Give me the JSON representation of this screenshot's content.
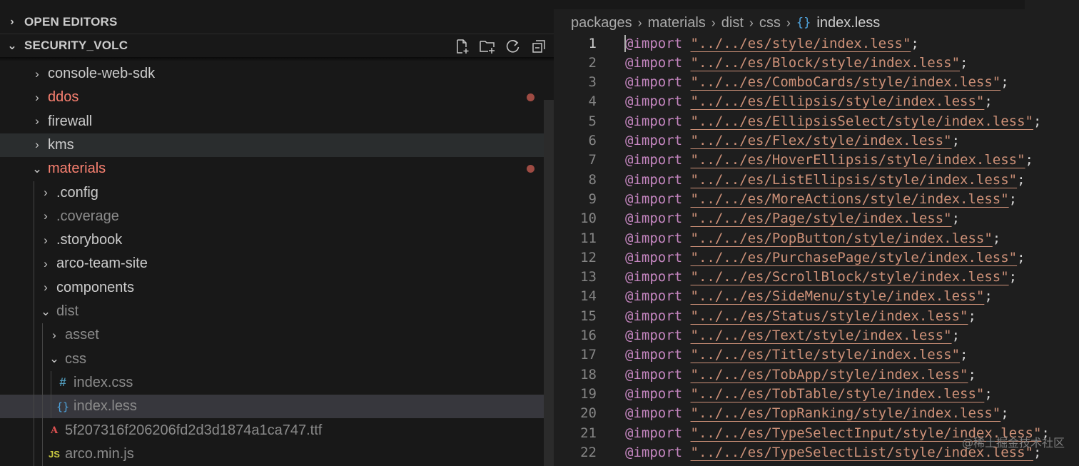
{
  "sidebar": {
    "open_editors_label": "OPEN EDITORS",
    "workspace_label": "SECURITY_VOLC",
    "actions": [
      {
        "icon": "new-file-icon"
      },
      {
        "icon": "new-folder-icon"
      },
      {
        "icon": "refresh-icon"
      },
      {
        "icon": "collapse-all-icon"
      }
    ],
    "tree": [
      {
        "label": "console-web-sdk",
        "type": "folder",
        "expanded": false,
        "depth": 0
      },
      {
        "label": "ddos",
        "type": "folder",
        "expanded": false,
        "depth": 0,
        "modified": true
      },
      {
        "label": "firewall",
        "type": "folder",
        "expanded": false,
        "depth": 0
      },
      {
        "label": "kms",
        "type": "folder",
        "expanded": false,
        "depth": 0,
        "hover": true
      },
      {
        "label": "materials",
        "type": "folder",
        "expanded": true,
        "depth": 0,
        "modified": true
      },
      {
        "label": ".config",
        "type": "folder",
        "expanded": false,
        "depth": 1
      },
      {
        "label": ".coverage",
        "type": "folder",
        "expanded": false,
        "depth": 1,
        "dim": true
      },
      {
        "label": ".storybook",
        "type": "folder",
        "expanded": false,
        "depth": 1
      },
      {
        "label": "arco-team-site",
        "type": "folder",
        "expanded": false,
        "depth": 1
      },
      {
        "label": "components",
        "type": "folder",
        "expanded": false,
        "depth": 1
      },
      {
        "label": "dist",
        "type": "folder",
        "expanded": true,
        "depth": 1,
        "dim": true
      },
      {
        "label": "asset",
        "type": "folder",
        "expanded": false,
        "depth": 2,
        "dim": true
      },
      {
        "label": "css",
        "type": "folder",
        "expanded": true,
        "depth": 2,
        "dim": true
      },
      {
        "label": "index.css",
        "type": "css",
        "depth": 3,
        "dim": true,
        "icon_glyph": "#"
      },
      {
        "label": "index.less",
        "type": "less",
        "depth": 3,
        "dim": true,
        "selected": true,
        "icon_glyph": "{}"
      },
      {
        "label": "5f207316f206206fd2d3d1874a1ca747.ttf",
        "type": "font",
        "depth": 2,
        "dim": true,
        "icon_glyph": "A"
      },
      {
        "label": "arco.min.js",
        "type": "js",
        "depth": 2,
        "dim": true,
        "icon_glyph": "JS"
      }
    ]
  },
  "colors": {
    "modified": "#f88070",
    "keyword": "#c586c0",
    "string": "#ce9178",
    "css_icon": "#519aba",
    "less_icon": "#4fa3dc",
    "js_icon": "#cbcb41",
    "font_icon": "#e05252"
  },
  "editor": {
    "breadcrumb": [
      "packages",
      "materials",
      "dist",
      "css"
    ],
    "breadcrumb_icon_glyph": "{}",
    "breadcrumb_file": "index.less",
    "active_line": 1,
    "lines": [
      {
        "n": "1",
        "kw": "@import",
        "str": "\"../../es/style/index.less\""
      },
      {
        "n": "2",
        "kw": "@import",
        "str": "\"../../es/Block/style/index.less\""
      },
      {
        "n": "3",
        "kw": "@import",
        "str": "\"../../es/ComboCards/style/index.less\""
      },
      {
        "n": "4",
        "kw": "@import",
        "str": "\"../../es/Ellipsis/style/index.less\""
      },
      {
        "n": "5",
        "kw": "@import",
        "str": "\"../../es/EllipsisSelect/style/index.less\""
      },
      {
        "n": "6",
        "kw": "@import",
        "str": "\"../../es/Flex/style/index.less\""
      },
      {
        "n": "7",
        "kw": "@import",
        "str": "\"../../es/HoverEllipsis/style/index.less\""
      },
      {
        "n": "8",
        "kw": "@import",
        "str": "\"../../es/ListEllipsis/style/index.less\""
      },
      {
        "n": "9",
        "kw": "@import",
        "str": "\"../../es/MoreActions/style/index.less\""
      },
      {
        "n": "10",
        "kw": "@import",
        "str": "\"../../es/Page/style/index.less\""
      },
      {
        "n": "11",
        "kw": "@import",
        "str": "\"../../es/PopButton/style/index.less\""
      },
      {
        "n": "12",
        "kw": "@import",
        "str": "\"../../es/PurchasePage/style/index.less\""
      },
      {
        "n": "13",
        "kw": "@import",
        "str": "\"../../es/ScrollBlock/style/index.less\""
      },
      {
        "n": "14",
        "kw": "@import",
        "str": "\"../../es/SideMenu/style/index.less\""
      },
      {
        "n": "15",
        "kw": "@import",
        "str": "\"../../es/Status/style/index.less\""
      },
      {
        "n": "16",
        "kw": "@import",
        "str": "\"../../es/Text/style/index.less\""
      },
      {
        "n": "17",
        "kw": "@import",
        "str": "\"../../es/Title/style/index.less\""
      },
      {
        "n": "18",
        "kw": "@import",
        "str": "\"../../es/TobApp/style/index.less\""
      },
      {
        "n": "19",
        "kw": "@import",
        "str": "\"../../es/TobTable/style/index.less\""
      },
      {
        "n": "20",
        "kw": "@import",
        "str": "\"../../es/TopRanking/style/index.less\""
      },
      {
        "n": "21",
        "kw": "@import",
        "str": "\"../../es/TypeSelectInput/style/index.less\""
      },
      {
        "n": "22",
        "kw": "@import",
        "str": "\"../../es/TypeSelectList/style/index.less\""
      }
    ],
    "line_end": ";"
  },
  "watermark": "@稀土掘金技术社区"
}
